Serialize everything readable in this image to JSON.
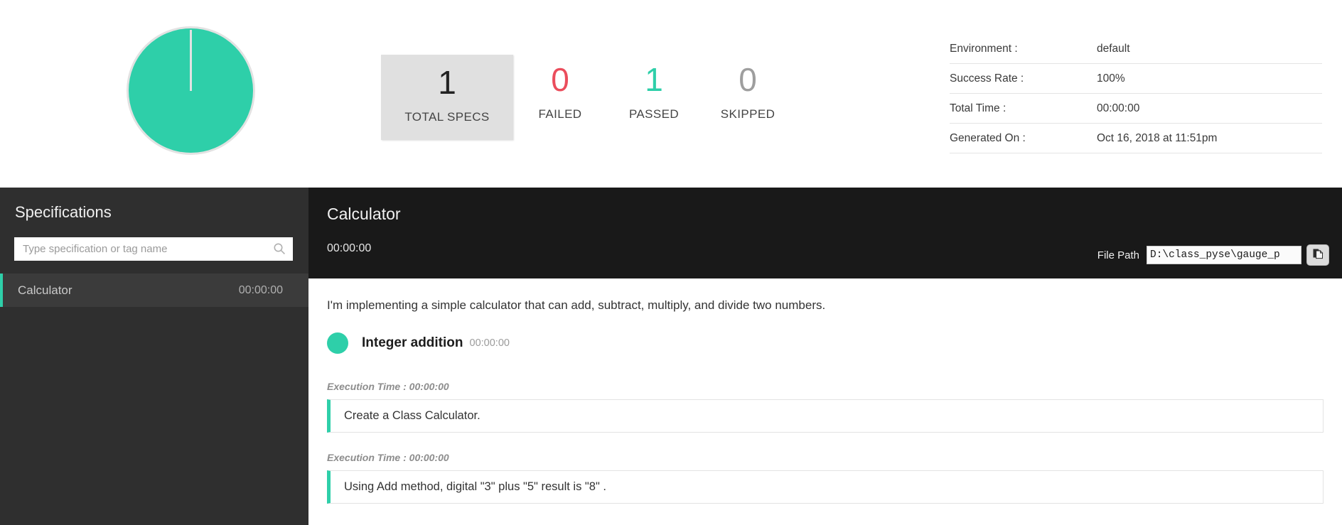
{
  "summary": {
    "chart": {
      "name": "pass-fail-pie-chart",
      "passed_percent": 100,
      "failed_percent": 0,
      "skipped_percent": 0,
      "passed_color": "#2ecfa9",
      "failed_color": "#eb4d5c",
      "skipped_color": "#9e9e9e"
    },
    "stats": [
      {
        "value": "1",
        "label": "TOTAL SPECS",
        "kind": "total"
      },
      {
        "value": "0",
        "label": "FAILED",
        "kind": "failed"
      },
      {
        "value": "1",
        "label": "PASSED",
        "kind": "passed"
      },
      {
        "value": "0",
        "label": "SKIPPED",
        "kind": "skipped"
      }
    ],
    "environment_table": [
      {
        "label": "Environment :",
        "value": "default"
      },
      {
        "label": "Success Rate :",
        "value": "100%"
      },
      {
        "label": "Total Time :",
        "value": "00:00:00"
      },
      {
        "label": "Generated On :",
        "value": "Oct 16, 2018 at 11:51pm"
      }
    ]
  },
  "sidebar": {
    "title": "Specifications",
    "search": {
      "placeholder": "Type specification or tag name",
      "value": "",
      "icon": "search-icon"
    },
    "items": [
      {
        "name": "Calculator",
        "time": "00:00:00",
        "selected": true
      }
    ]
  },
  "main": {
    "header": {
      "title": "Calculator",
      "time": "00:00:00",
      "file_path_label": "File Path",
      "file_path_value": "D:\\class_pyse\\gauge_p",
      "copy_button_icon": "copy-document-icon"
    },
    "description": "I'm implementing a simple calculator that can add, subtract, multiply, and divide two numbers.",
    "scenario": {
      "name": "Integer addition",
      "time": "00:00:00",
      "status": "passed",
      "status_color": "#2ecfa9"
    },
    "steps": [
      {
        "exec_time_label": "Execution Time : 00:00:00",
        "text": "Create a Class Calculator."
      },
      {
        "exec_time_label": "Execution Time : 00:00:00",
        "text": "Using Add method, digital \"3\" plus \"5\" result is \"8\" ."
      }
    ]
  }
}
